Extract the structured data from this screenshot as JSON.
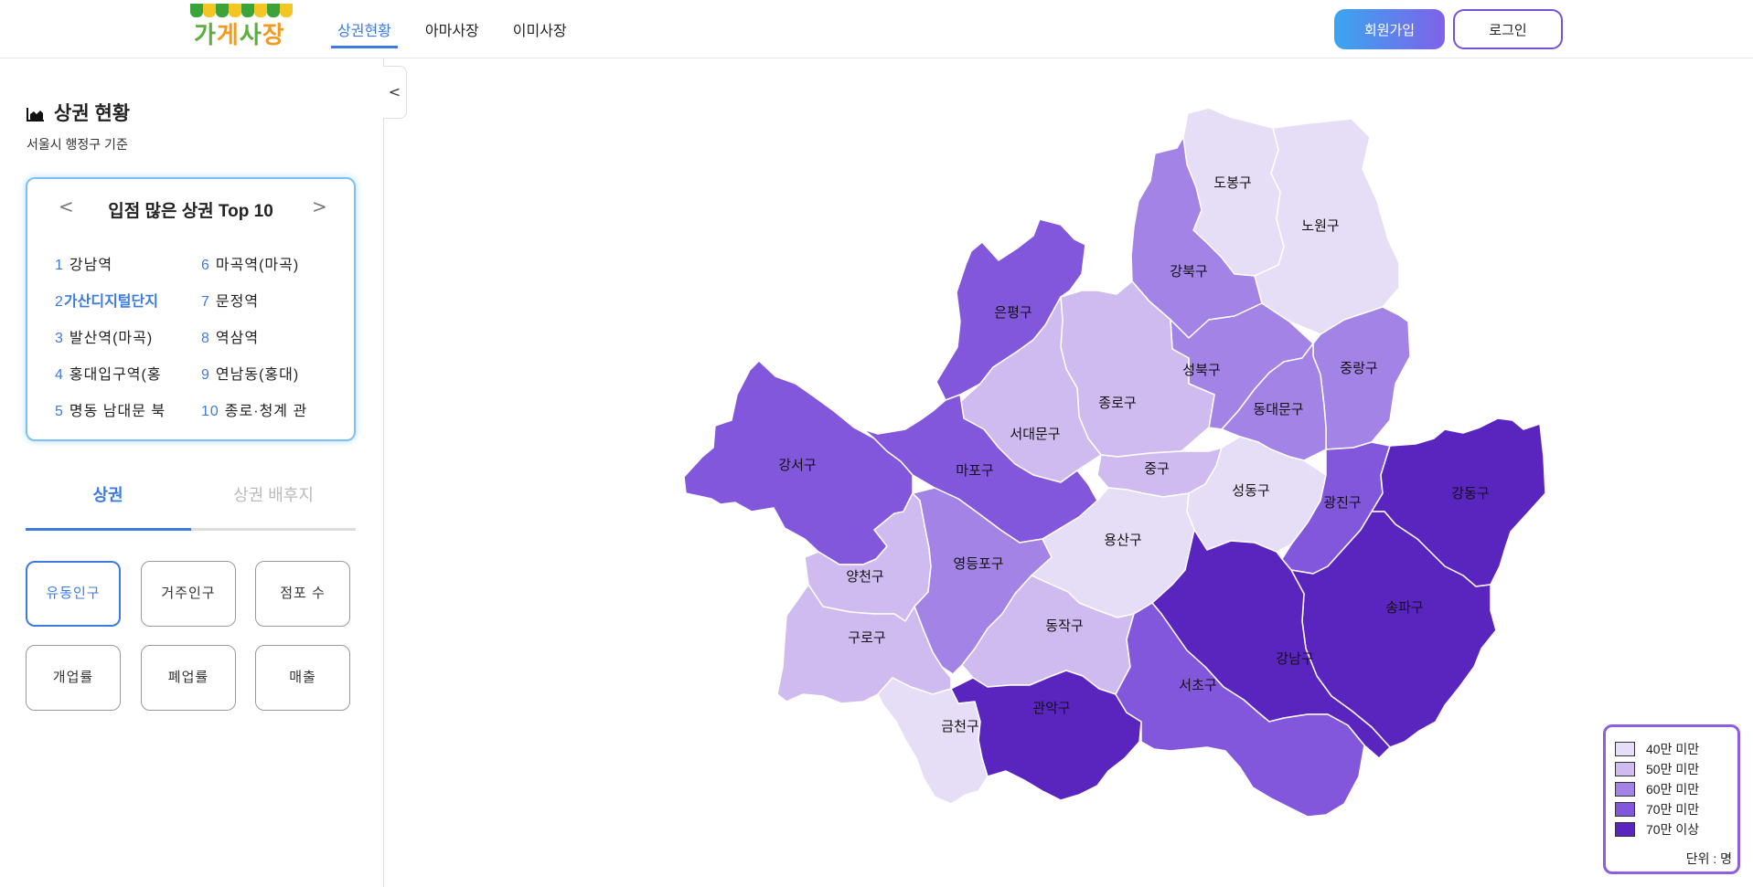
{
  "header": {
    "logo_text": [
      "가",
      "게",
      "사",
      "장"
    ],
    "nav": [
      "상권현황",
      "아마사장",
      "이미사장"
    ],
    "signup_label": "회원가입",
    "login_label": "로그인"
  },
  "sidebar": {
    "collapse_label": "<",
    "title": "상권 현황",
    "subtitle": "서울시 행정구 기준",
    "top10": {
      "title": "입점 많은 상권 Top 10",
      "prev": "<",
      "next": ">",
      "left": [
        {
          "num": "1",
          "name": "강남역"
        },
        {
          "num": "2",
          "name": "가산디지털단지"
        },
        {
          "num": "3",
          "name": "발산역(마곡)"
        },
        {
          "num": "4",
          "name": "홍대입구역(홍"
        },
        {
          "num": "5",
          "name": "명동 남대문 북"
        }
      ],
      "right": [
        {
          "num": "6",
          "name": "마곡역(마곡)"
        },
        {
          "num": "7",
          "name": "문정역"
        },
        {
          "num": "8",
          "name": "역삼역"
        },
        {
          "num": "9",
          "name": "연남동(홍대)"
        },
        {
          "num": "10",
          "name": "종로·청계 관"
        }
      ]
    },
    "tabs": [
      "상권",
      "상권 배후지"
    ],
    "metrics": [
      "유동인구",
      "거주인구",
      "점포 수",
      "개업률",
      "폐업률",
      "매출"
    ]
  },
  "map": {
    "colors": [
      "#e6ddf6",
      "#d0bbf0",
      "#a383e5",
      "#8257dc",
      "#5a25bf"
    ],
    "districts": [
      {
        "name": "도봉구",
        "level": 0
      },
      {
        "name": "노원구",
        "level": 0
      },
      {
        "name": "강북구",
        "level": 2
      },
      {
        "name": "은평구",
        "level": 3
      },
      {
        "name": "성북구",
        "level": 2
      },
      {
        "name": "중랑구",
        "level": 2
      },
      {
        "name": "종로구",
        "level": 1
      },
      {
        "name": "동대문구",
        "level": 2
      },
      {
        "name": "서대문구",
        "level": 1
      },
      {
        "name": "강서구",
        "level": 3
      },
      {
        "name": "마포구",
        "level": 3
      },
      {
        "name": "중구",
        "level": 1
      },
      {
        "name": "성동구",
        "level": 0
      },
      {
        "name": "광진구",
        "level": 3
      },
      {
        "name": "강동구",
        "level": 4
      },
      {
        "name": "양천구",
        "level": 1
      },
      {
        "name": "영등포구",
        "level": 2
      },
      {
        "name": "용산구",
        "level": 0
      },
      {
        "name": "구로구",
        "level": 1
      },
      {
        "name": "동작구",
        "level": 1
      },
      {
        "name": "송파구",
        "level": 4
      },
      {
        "name": "강남구",
        "level": 4
      },
      {
        "name": "금천구",
        "level": 0
      },
      {
        "name": "관악구",
        "level": 4
      },
      {
        "name": "서초구",
        "level": 3
      }
    ]
  },
  "legend": {
    "items": [
      "40만 미만",
      "50만 미만",
      "60만 미만",
      "70만 미만",
      "70만 이상"
    ],
    "unit": "단위 : 명"
  }
}
